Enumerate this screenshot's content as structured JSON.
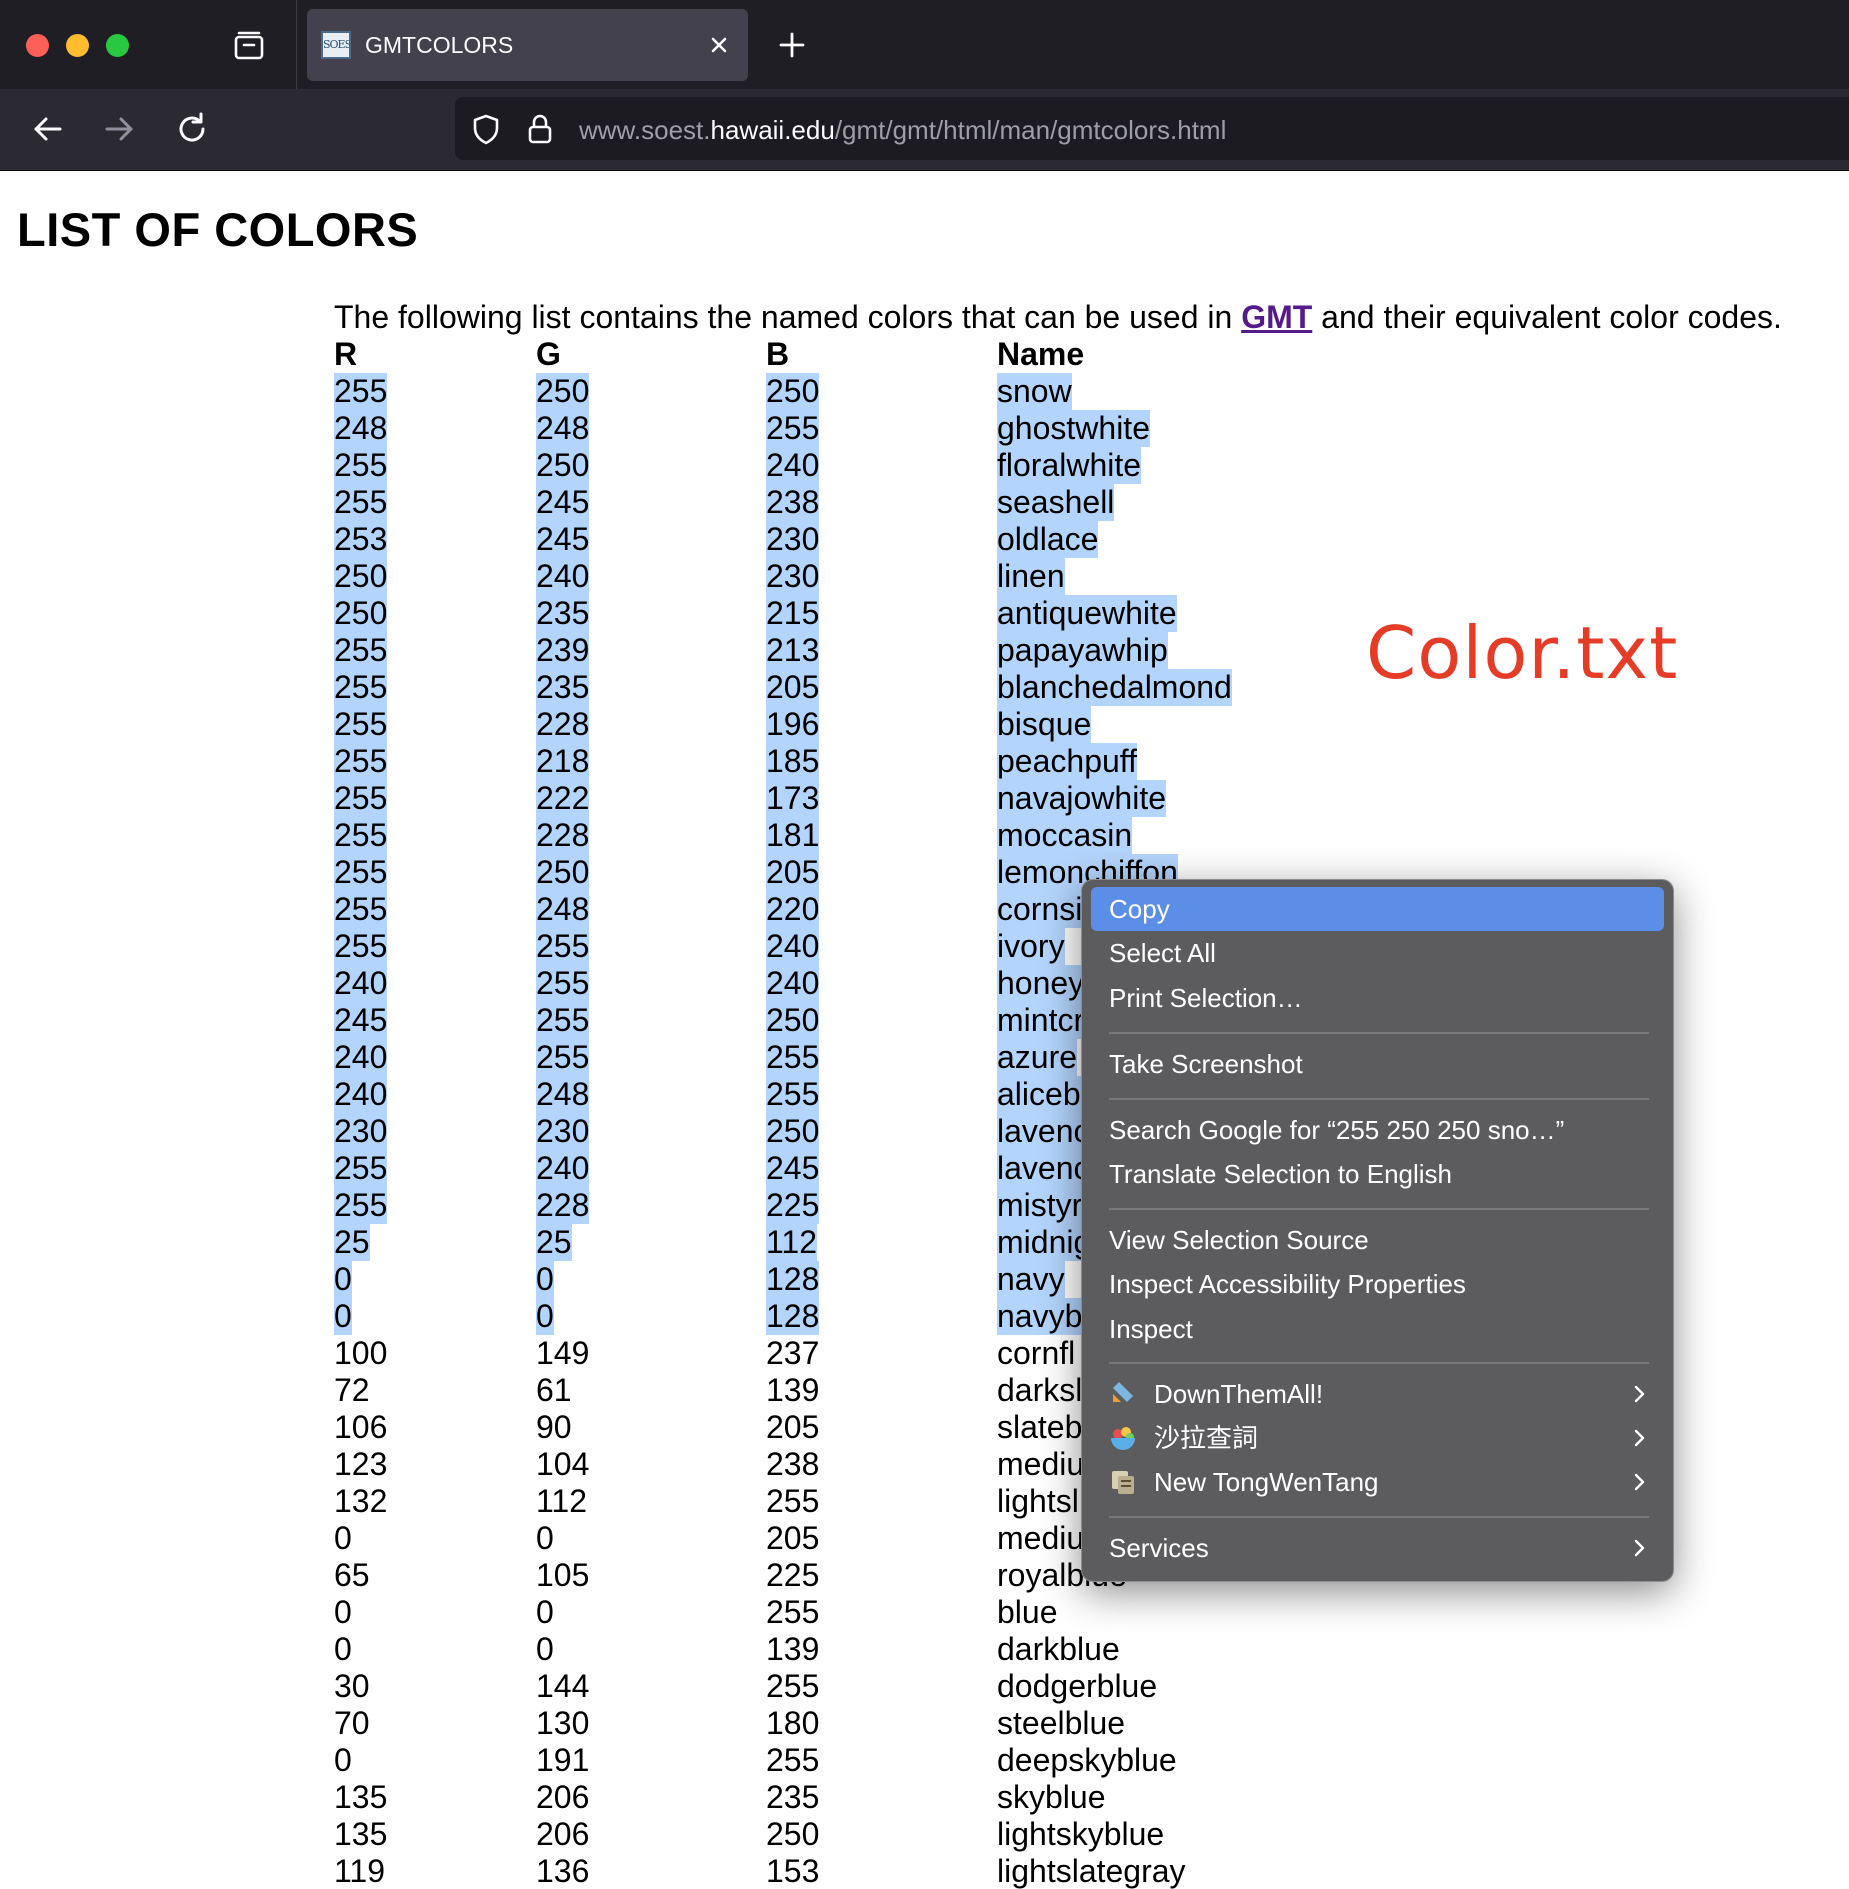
{
  "browser": {
    "tab": {
      "favicon_text": "SOEST",
      "title": "GMTCOLORS"
    },
    "url": {
      "host": "www.soest.hawaii.edu",
      "host_prefix": "www.soest.",
      "host_domain": "hawaii.edu",
      "path": "/gmt/gmt/html/man/gmtcolors.html"
    },
    "icons": [
      "tab-overview-icon",
      "close-icon",
      "plus-icon",
      "back-arrow-icon",
      "forward-arrow-icon",
      "reload-icon",
      "shield-icon",
      "lock-icon"
    ]
  },
  "page": {
    "title": "LIST OF COLORS",
    "intro_before": "The following list contains the named colors that can be used in ",
    "intro_link": "GMT",
    "intro_after": " and their equivalent color codes.",
    "headers": {
      "r": "R",
      "g": "G",
      "b": "B",
      "name": "Name"
    },
    "rows": [
      {
        "r": "255",
        "g": "250",
        "b": "250",
        "name": "snow"
      },
      {
        "r": "248",
        "g": "248",
        "b": "255",
        "name": "ghostwhite"
      },
      {
        "r": "255",
        "g": "250",
        "b": "240",
        "name": "floralwhite"
      },
      {
        "r": "255",
        "g": "245",
        "b": "238",
        "name": "seashell"
      },
      {
        "r": "253",
        "g": "245",
        "b": "230",
        "name": "oldlace"
      },
      {
        "r": "250",
        "g": "240",
        "b": "230",
        "name": "linen"
      },
      {
        "r": "250",
        "g": "235",
        "b": "215",
        "name": "antiquewhite"
      },
      {
        "r": "255",
        "g": "239",
        "b": "213",
        "name": "papayawhip"
      },
      {
        "r": "255",
        "g": "235",
        "b": "205",
        "name": "blanchedalmond"
      },
      {
        "r": "255",
        "g": "228",
        "b": "196",
        "name": "bisque"
      },
      {
        "r": "255",
        "g": "218",
        "b": "185",
        "name": "peachpuff"
      },
      {
        "r": "255",
        "g": "222",
        "b": "173",
        "name": "navajowhite"
      },
      {
        "r": "255",
        "g": "228",
        "b": "181",
        "name": "moccasin"
      },
      {
        "r": "255",
        "g": "250",
        "b": "205",
        "name": "lemonchiffon"
      },
      {
        "r": "255",
        "g": "248",
        "b": "220",
        "name": "cornsi"
      },
      {
        "r": "255",
        "g": "255",
        "b": "240",
        "name": "ivory"
      },
      {
        "r": "240",
        "g": "255",
        "b": "240",
        "name": "honey"
      },
      {
        "r": "245",
        "g": "255",
        "b": "250",
        "name": "mintcr"
      },
      {
        "r": "240",
        "g": "255",
        "b": "255",
        "name": "azure"
      },
      {
        "r": "240",
        "g": "248",
        "b": "255",
        "name": "aliceb"
      },
      {
        "r": "230",
        "g": "230",
        "b": "250",
        "name": "lavenc"
      },
      {
        "r": "255",
        "g": "240",
        "b": "245",
        "name": "lavenc"
      },
      {
        "r": "255",
        "g": "228",
        "b": "225",
        "name": "mistyr"
      },
      {
        "r": "25",
        "g": "25",
        "b": "112",
        "name": "midnig"
      },
      {
        "r": "0",
        "g": "0",
        "b": "128",
        "name": "navy"
      },
      {
        "r": "0",
        "g": "0",
        "b": "128",
        "name": "navyb"
      },
      {
        "r": "100",
        "g": "149",
        "b": "237",
        "name": "cornfl"
      },
      {
        "r": "72",
        "g": "61",
        "b": "139",
        "name": "darksl"
      },
      {
        "r": "106",
        "g": "90",
        "b": "205",
        "name": "slateb"
      },
      {
        "r": "123",
        "g": "104",
        "b": "238",
        "name": "mediu"
      },
      {
        "r": "132",
        "g": "112",
        "b": "255",
        "name": "lightsl"
      },
      {
        "r": "0",
        "g": "0",
        "b": "205",
        "name": "mediu"
      },
      {
        "r": "65",
        "g": "105",
        "b": "225",
        "name": "royalblue"
      },
      {
        "r": "0",
        "g": "0",
        "b": "255",
        "name": "blue"
      },
      {
        "r": "0",
        "g": "0",
        "b": "139",
        "name": "darkblue"
      },
      {
        "r": "30",
        "g": "144",
        "b": "255",
        "name": "dodgerblue"
      },
      {
        "r": "70",
        "g": "130",
        "b": "180",
        "name": "steelblue"
      },
      {
        "r": "0",
        "g": "191",
        "b": "255",
        "name": "deepskyblue"
      },
      {
        "r": "135",
        "g": "206",
        "b": "235",
        "name": "skyblue"
      },
      {
        "r": "135",
        "g": "206",
        "b": "250",
        "name": "lightskyblue"
      },
      {
        "r": "119",
        "g": "136",
        "b": "153",
        "name": "lightslategray"
      }
    ],
    "selected_row_count": 26,
    "annotation": "Color.txt",
    "annotation_color": "#e53c27",
    "selection_color": "#b3d4fc",
    "link_color": "#551a8b"
  },
  "context_menu": {
    "items": {
      "copy": "Copy",
      "select_all": "Select All",
      "print_selection": "Print Selection…",
      "take_screenshot": "Take Screenshot",
      "search_google": "Search Google for “255 250 250 sno…”",
      "translate": "Translate Selection to English",
      "view_source": "View Selection Source",
      "inspect_accessibility": "Inspect Accessibility Properties",
      "inspect": "Inspect",
      "downthemall": "DownThemAll!",
      "salad_dict": "沙拉查詞",
      "tongwentang": "New TongWenTang",
      "services": "Services"
    },
    "highlight_color": "#5b8ee6"
  }
}
